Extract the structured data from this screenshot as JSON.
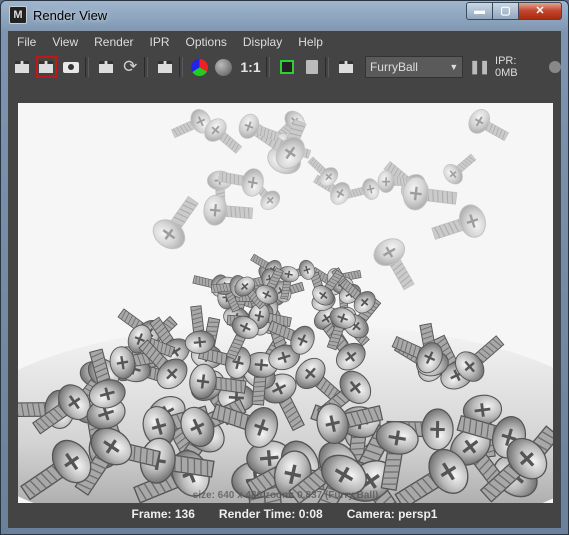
{
  "window": {
    "title": "Render View"
  },
  "titlebar_buttons": {
    "minimize": "▬",
    "maximize": "▢",
    "close": "✕"
  },
  "menu": [
    "File",
    "View",
    "Render",
    "IPR",
    "Options",
    "Display",
    "Help"
  ],
  "toolbar": {
    "icons": [
      "redo-render-icon",
      "render-region-icon",
      "snapshot-icon",
      "ipr-render-icon",
      "refresh-icon",
      "render-settings-icon",
      "rgb-channels-icon",
      "alpha-channel-icon"
    ],
    "one_to_one": "1:1",
    "renderer": "FurryBall",
    "ipr_status": "IPR: 0MB"
  },
  "viewport": {
    "overlay": "size: 640 x 480 zoom: 0.837   (Furry Ball)"
  },
  "status": {
    "frame": "Frame: 136",
    "render_time": "Render Time: 0:08",
    "camera": "Camera: persp1"
  }
}
